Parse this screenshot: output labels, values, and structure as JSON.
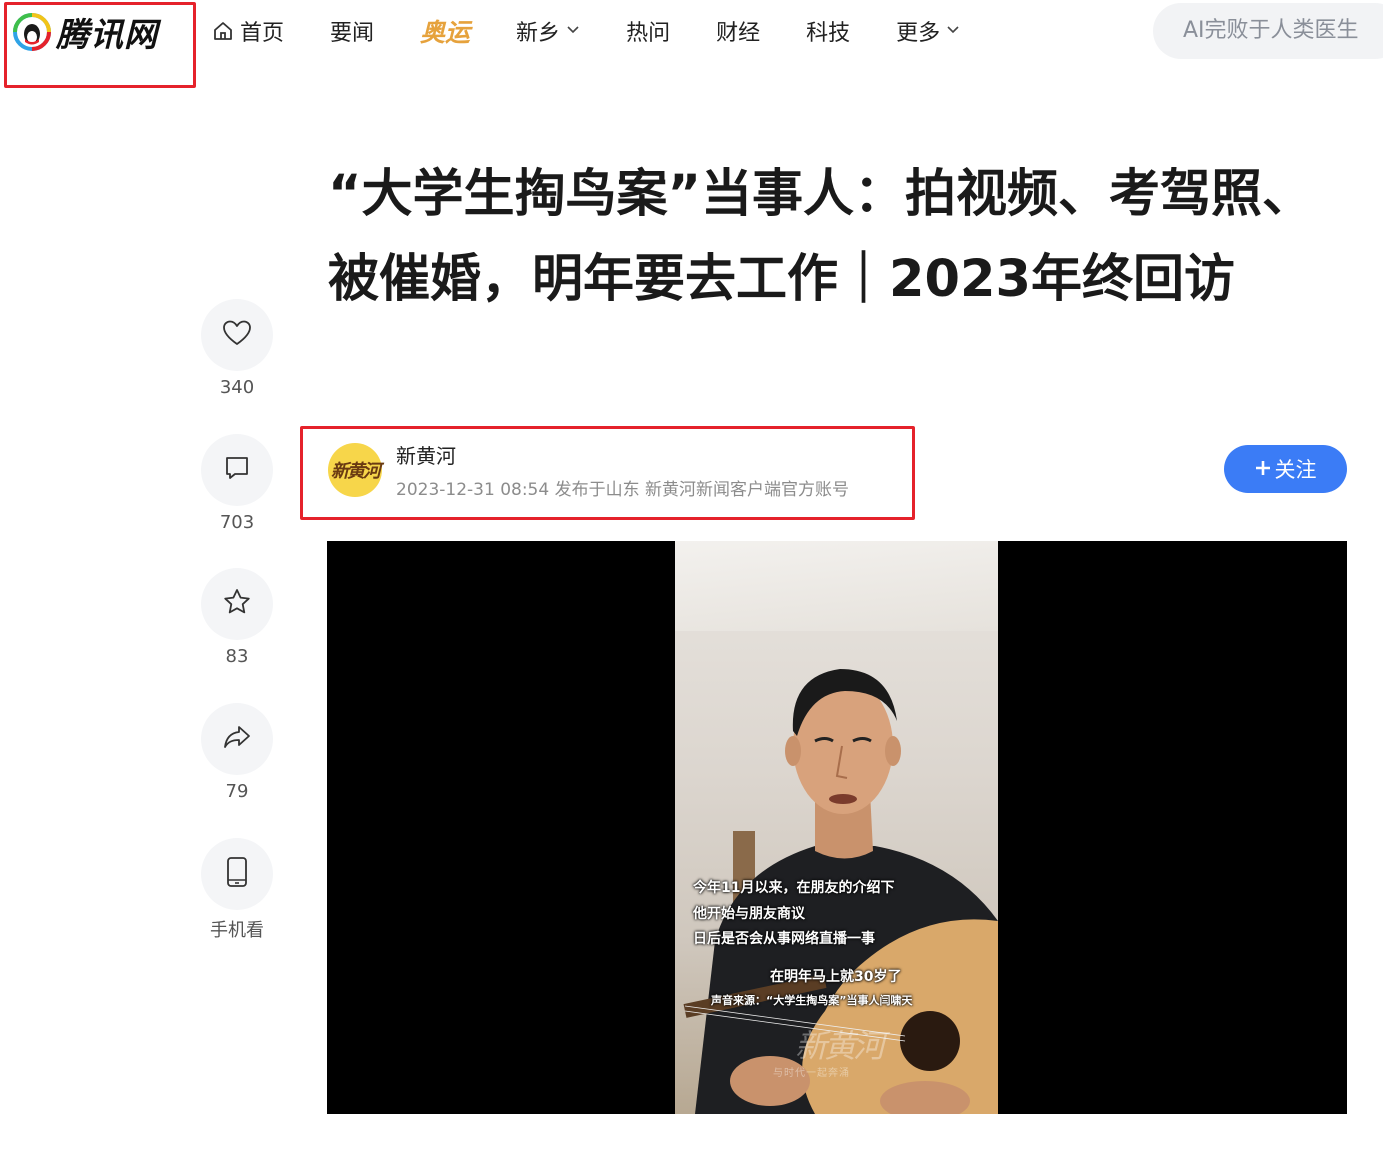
{
  "site": {
    "logo_text": "腾讯网"
  },
  "nav": {
    "items": [
      {
        "label": "首页"
      },
      {
        "label": "要闻"
      },
      {
        "label": "奥运"
      },
      {
        "label": "新乡"
      },
      {
        "label": "热问"
      },
      {
        "label": "财经"
      },
      {
        "label": "科技"
      },
      {
        "label": "更多"
      }
    ],
    "search_placeholder": "AI完败于人类医生"
  },
  "article": {
    "title": "“大学生掏鸟案”当事人：拍视频、考驾照、被催婚，明年要去工作｜2023年终回访"
  },
  "toolbar": {
    "like_count": "340",
    "comment_count": "703",
    "favorite_count": "83",
    "share_count": "79",
    "mobile_label": "手机看"
  },
  "author": {
    "avatar_text": "新黄河",
    "name": "新黄河",
    "meta": "2023-12-31 08:54  发布于山东  新黄河新闻客户端官方账号",
    "follow_label": "关注"
  },
  "video": {
    "subtitles": [
      "今年11月以来，在朋友的介绍下",
      "他开始与朋友商议",
      "日后是否会从事网络直播一事",
      "在明年马上就30岁了",
      "声音来源：“大学生掏鸟案”当事人闫啸天"
    ],
    "watermark": "新黄河",
    "watermark_sub": "与时代一起奔涌"
  },
  "colors": {
    "accent_blue": "#3b7cf6",
    "highlight_red": "#e5222b",
    "olympic_gold": "#e6a23c"
  }
}
